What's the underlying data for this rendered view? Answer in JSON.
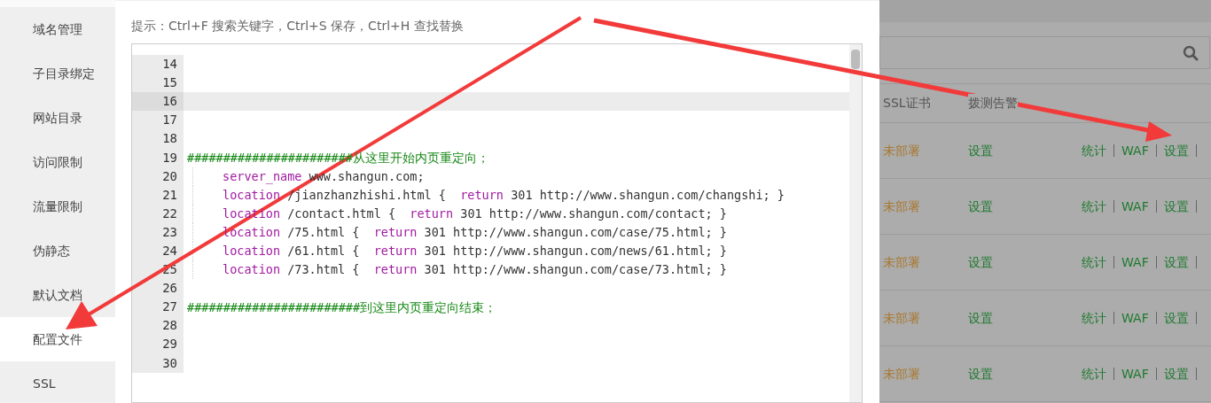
{
  "sidebar": {
    "items": [
      {
        "label": "域名管理",
        "selected": false
      },
      {
        "label": "子目录绑定",
        "selected": false
      },
      {
        "label": "网站目录",
        "selected": false
      },
      {
        "label": "访问限制",
        "selected": false
      },
      {
        "label": "流量限制",
        "selected": false
      },
      {
        "label": "伪静态",
        "selected": false
      },
      {
        "label": "默认文档",
        "selected": false
      },
      {
        "label": "配置文件",
        "selected": true
      },
      {
        "label": "SSL",
        "selected": false
      }
    ]
  },
  "editor": {
    "hint": "提示：Ctrl+F 搜索关键字，Ctrl+S 保存，Ctrl+H 查找替换",
    "lines": [
      {
        "number": "14",
        "active": false,
        "indent": false
      },
      {
        "number": "15",
        "active": false,
        "indent": false
      },
      {
        "number": "16",
        "active": true,
        "indent": false
      },
      {
        "number": "17",
        "active": false,
        "indent": false
      },
      {
        "number": "18",
        "active": false,
        "indent": false
      },
      {
        "number": "19",
        "active": false,
        "indent": false,
        "tokens": [
          {
            "kind": "comment",
            "text": "#######################从这里开始内页重定向；"
          }
        ]
      },
      {
        "number": "20",
        "active": false,
        "indent": true,
        "tokens": [
          {
            "kind": "keyword",
            "text": "server_name"
          },
          {
            "kind": "plain",
            "text": " www.shangun.com;"
          }
        ]
      },
      {
        "number": "21",
        "active": false,
        "indent": true,
        "tokens": [
          {
            "kind": "keyword",
            "text": "location"
          },
          {
            "kind": "plain",
            "text": " /jianzhanzhishi.html {  "
          },
          {
            "kind": "keyword",
            "text": "return"
          },
          {
            "kind": "plain",
            "text": " 301 http://www.shangun.com/changshi; }"
          }
        ]
      },
      {
        "number": "22",
        "active": false,
        "indent": true,
        "tokens": [
          {
            "kind": "keyword",
            "text": "location"
          },
          {
            "kind": "plain",
            "text": " /contact.html {  "
          },
          {
            "kind": "keyword",
            "text": "return"
          },
          {
            "kind": "plain",
            "text": " 301 http://www.shangun.com/contact; }"
          }
        ]
      },
      {
        "number": "23",
        "active": false,
        "indent": true,
        "tokens": [
          {
            "kind": "keyword",
            "text": "location"
          },
          {
            "kind": "plain",
            "text": " /75.html {  "
          },
          {
            "kind": "keyword",
            "text": "return"
          },
          {
            "kind": "plain",
            "text": " 301 http://www.shangun.com/case/75.html; }"
          }
        ]
      },
      {
        "number": "24",
        "active": false,
        "indent": true,
        "tokens": [
          {
            "kind": "keyword",
            "text": "location"
          },
          {
            "kind": "plain",
            "text": " /61.html {  "
          },
          {
            "kind": "keyword",
            "text": "return"
          },
          {
            "kind": "plain",
            "text": " 301 http://www.shangun.com/news/61.html; }"
          }
        ]
      },
      {
        "number": "25",
        "active": false,
        "indent": true,
        "tokens": [
          {
            "kind": "keyword",
            "text": "location"
          },
          {
            "kind": "plain",
            "text": " /73.html {  "
          },
          {
            "kind": "keyword",
            "text": "return"
          },
          {
            "kind": "plain",
            "text": " 301 http://www.shangun.com/case/73.html; }"
          }
        ]
      },
      {
        "number": "26",
        "active": false,
        "indent": false
      },
      {
        "number": "27",
        "active": false,
        "indent": false,
        "tokens": [
          {
            "kind": "comment",
            "text": "########################到这里内页重定向结束；"
          }
        ]
      },
      {
        "number": "28",
        "active": false,
        "indent": false
      },
      {
        "number": "29",
        "active": false,
        "indent": false
      },
      {
        "number": "30",
        "active": false,
        "indent": false
      }
    ]
  },
  "table": {
    "columns": [
      "SSL证书",
      "拨测告警"
    ],
    "rows": [
      {
        "ssl": "未部署",
        "alert": "设置",
        "actions": [
          "统计",
          "WAF",
          "设置"
        ]
      },
      {
        "ssl": "未部署",
        "alert": "设置",
        "actions": [
          "统计",
          "WAF",
          "设置"
        ]
      },
      {
        "ssl": "未部署",
        "alert": "设置",
        "actions": [
          "统计",
          "WAF",
          "设置"
        ]
      },
      {
        "ssl": "未部署",
        "alert": "设置",
        "actions": [
          "统计",
          "WAF",
          "设置"
        ]
      },
      {
        "ssl": "未部署",
        "alert": "设置",
        "actions": [
          "统计",
          "WAF",
          "设置"
        ]
      }
    ]
  }
}
